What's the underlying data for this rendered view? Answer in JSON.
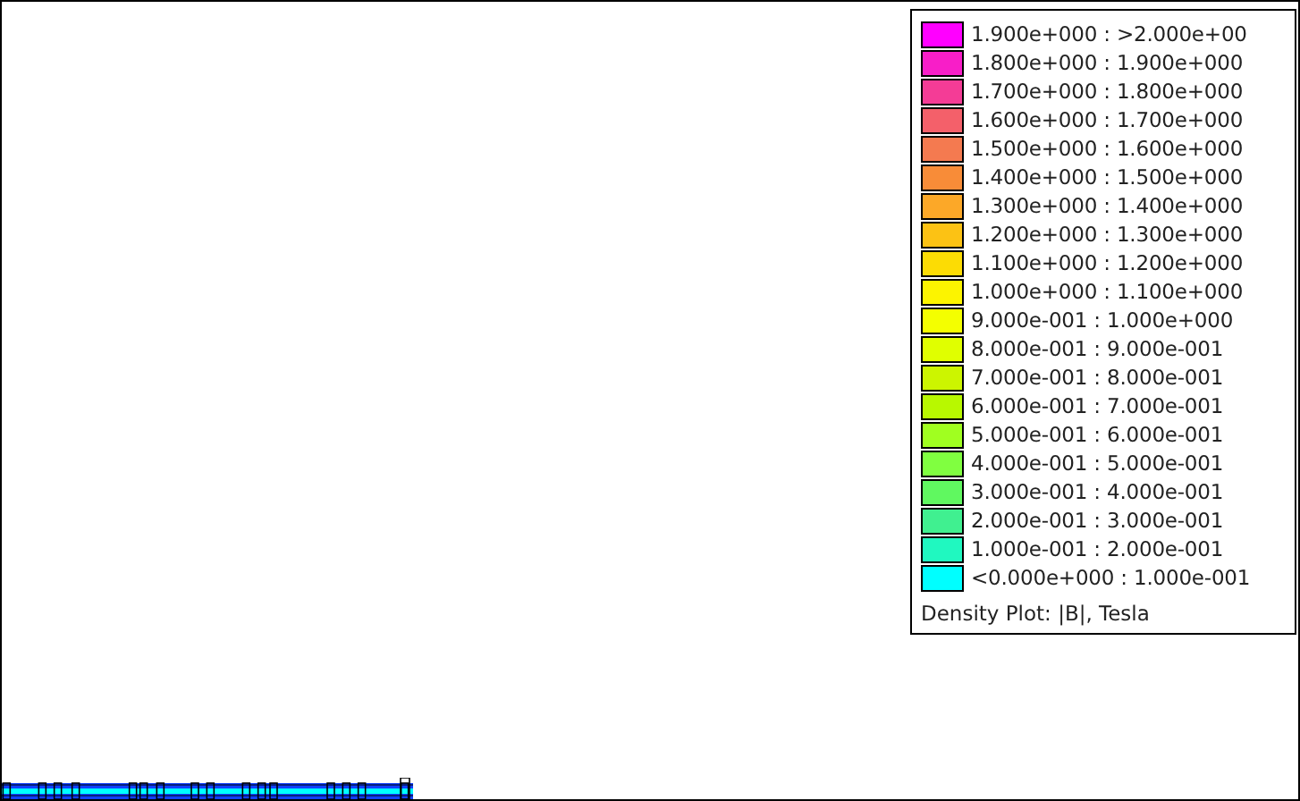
{
  "legend": {
    "items": [
      {
        "label": "1.900e+000 : >2.000e+00",
        "color": "#ff00ff"
      },
      {
        "label": "1.800e+000 : 1.900e+000",
        "color": "#f81ec8"
      },
      {
        "label": "1.700e+000 : 1.800e+000",
        "color": "#f43c96"
      },
      {
        "label": "1.600e+000 : 1.700e+000",
        "color": "#f4606a"
      },
      {
        "label": "1.500e+000 : 1.600e+000",
        "color": "#f47a50"
      },
      {
        "label": "1.400e+000 : 1.500e+000",
        "color": "#f88c38"
      },
      {
        "label": "1.300e+000 : 1.400e+000",
        "color": "#fca828"
      },
      {
        "label": "1.200e+000 : 1.300e+000",
        "color": "#fcc214"
      },
      {
        "label": "1.100e+000 : 1.200e+000",
        "color": "#fcdc04"
      },
      {
        "label": "1.000e+000 : 1.100e+000",
        "color": "#fcf400"
      },
      {
        "label": "9.000e-001 : 1.000e+000",
        "color": "#f4ff00"
      },
      {
        "label": "8.000e-001 : 9.000e-001",
        "color": "#e0ff00"
      },
      {
        "label": "7.000e-001 : 8.000e-001",
        "color": "#ccf500"
      },
      {
        "label": "6.000e-001 : 7.000e-001",
        "color": "#b8f800"
      },
      {
        "label": "5.000e-001 : 6.000e-001",
        "color": "#a0ff20"
      },
      {
        "label": "4.000e-001 : 5.000e-001",
        "color": "#80ff40"
      },
      {
        "label": "3.000e-001 : 4.000e-001",
        "color": "#60f860"
      },
      {
        "label": "2.000e-001 : 3.000e-001",
        "color": "#40f090"
      },
      {
        "label": "1.000e-001 : 2.000e-001",
        "color": "#20f8c0"
      },
      {
        "label": "<0.000e+000 : 1.000e-001",
        "color": "#00ffff"
      }
    ],
    "caption": "Density Plot: |B|, Tesla"
  }
}
